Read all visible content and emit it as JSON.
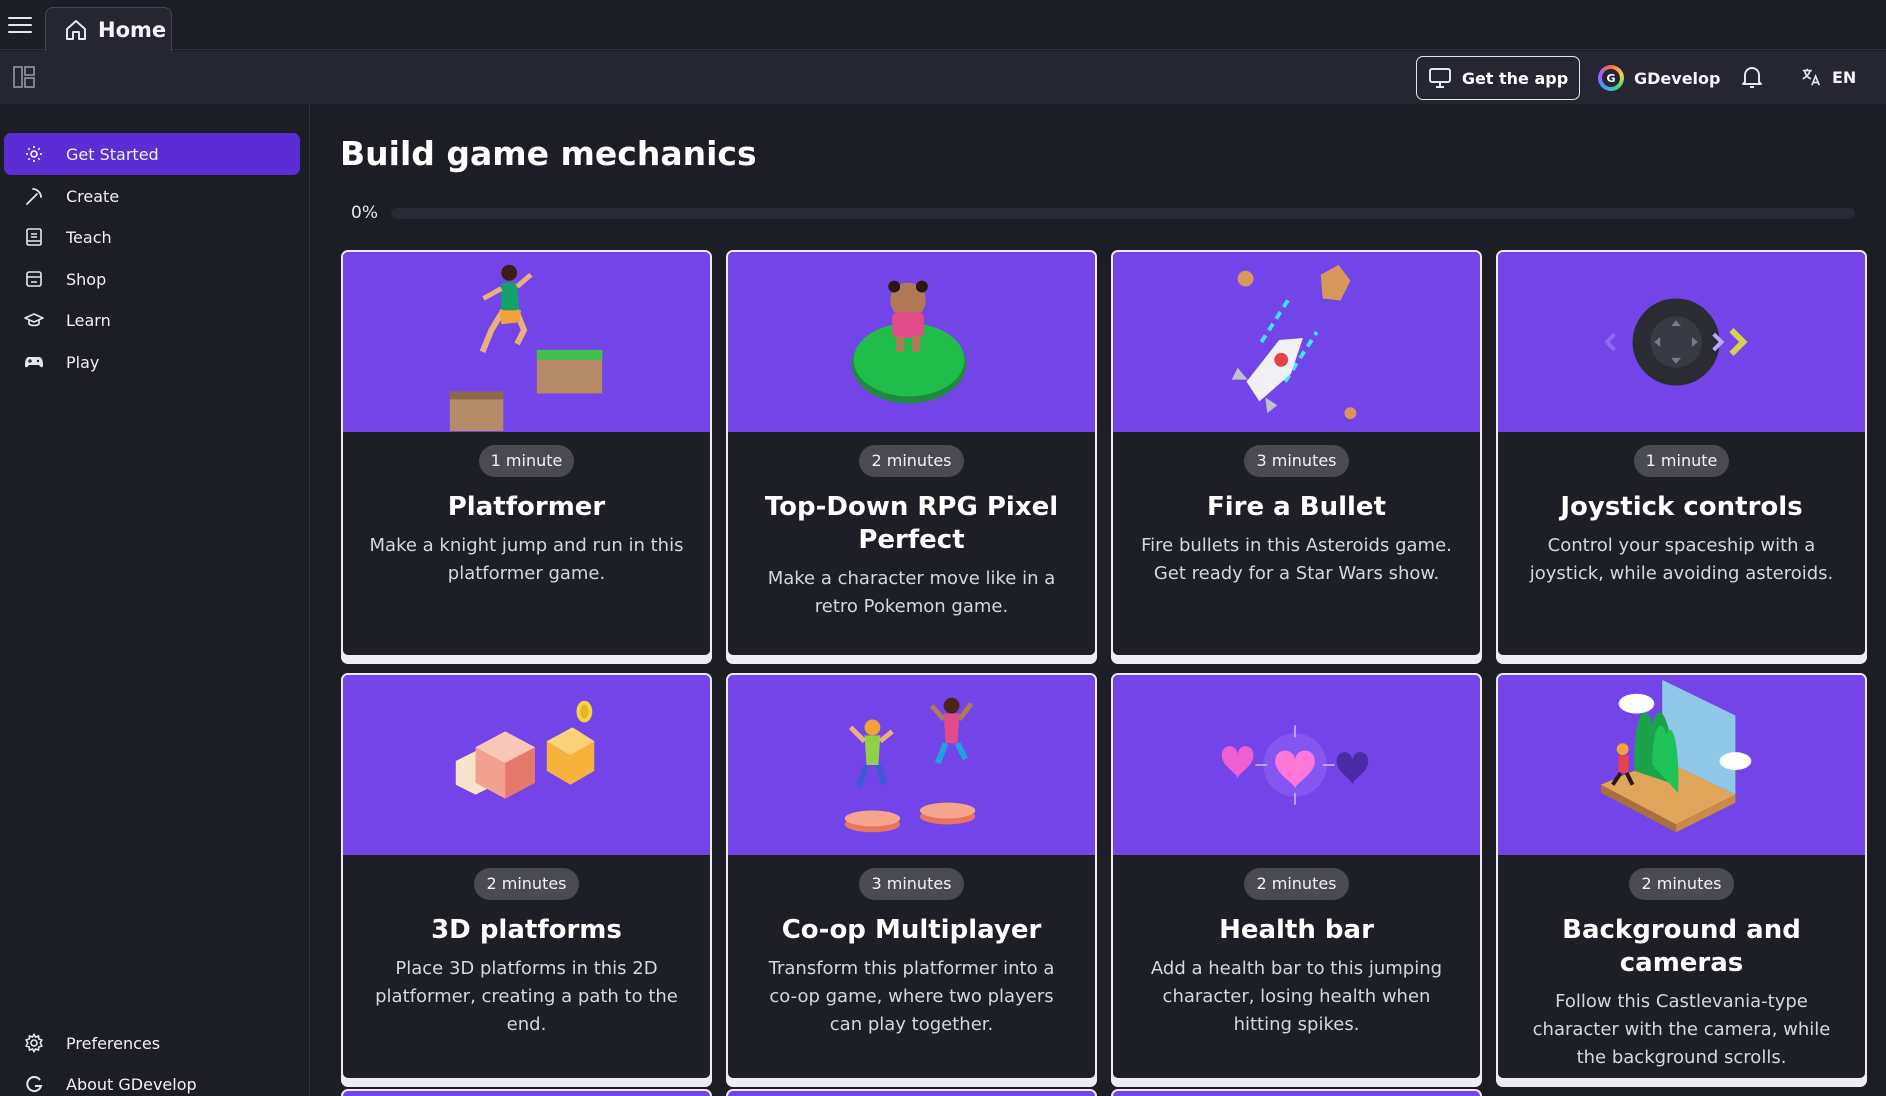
{
  "tab": {
    "label": "Home"
  },
  "toolbar": {
    "get_app_label": "Get the app",
    "brand_label": "GDevelop",
    "lang_label": "EN"
  },
  "sidebar": {
    "items": [
      {
        "label": "Get Started",
        "icon": "sun-icon",
        "active": true
      },
      {
        "label": "Create",
        "icon": "pickaxe-icon"
      },
      {
        "label": "Teach",
        "icon": "book-icon"
      },
      {
        "label": "Shop",
        "icon": "store-icon"
      },
      {
        "label": "Learn",
        "icon": "graduation-cap-icon"
      },
      {
        "label": "Play",
        "icon": "gamepad-icon"
      }
    ],
    "bottom": [
      {
        "label": "Preferences",
        "icon": "gear-icon"
      },
      {
        "label": "About GDevelop",
        "icon": "gdevelop-logo-icon"
      }
    ]
  },
  "main": {
    "title": "Build game mechanics",
    "progress": {
      "label": "0%",
      "value": 0
    },
    "cards": [
      {
        "duration": "1 minute",
        "title": "Platformer",
        "desc": "Make a knight jump and run in this platformer game.",
        "image": "platformer-illustration"
      },
      {
        "duration": "2 minutes",
        "title": "Top-Down RPG Pixel Perfect",
        "desc": "Make a character move like in a retro Pokemon game.",
        "image": "rpg-illustration"
      },
      {
        "duration": "3 minutes",
        "title": "Fire a Bullet",
        "desc": "Fire bullets in this Asteroids game. Get ready for a Star Wars show.",
        "image": "rocket-illustration"
      },
      {
        "duration": "1 minute",
        "title": "Joystick controls",
        "desc": "Control your spaceship with a joystick, while avoiding asteroids.",
        "image": "joystick-illustration"
      },
      {
        "duration": "2 minutes",
        "title": "3D platforms",
        "desc": "Place 3D platforms in this 2D platformer, creating a path to the end.",
        "image": "cubes-illustration"
      },
      {
        "duration": "3 minutes",
        "title": "Co-op Multiplayer",
        "desc": "Transform this platformer into a co-op game, where two players can play together.",
        "image": "coop-illustration"
      },
      {
        "duration": "2 minutes",
        "title": "Health bar",
        "desc": "Add a health bar to this jumping character, losing health when hitting spikes.",
        "image": "hearts-illustration"
      },
      {
        "duration": "2 minutes",
        "title": "Background and cameras",
        "desc": "Follow this Castlevania-type character with the camera, while the background scrolls.",
        "image": "castle-illustration"
      }
    ]
  },
  "colors": {
    "accent": "#5a2ed4",
    "card_image_bg": "#7345e8",
    "background": "#1d1d26"
  }
}
